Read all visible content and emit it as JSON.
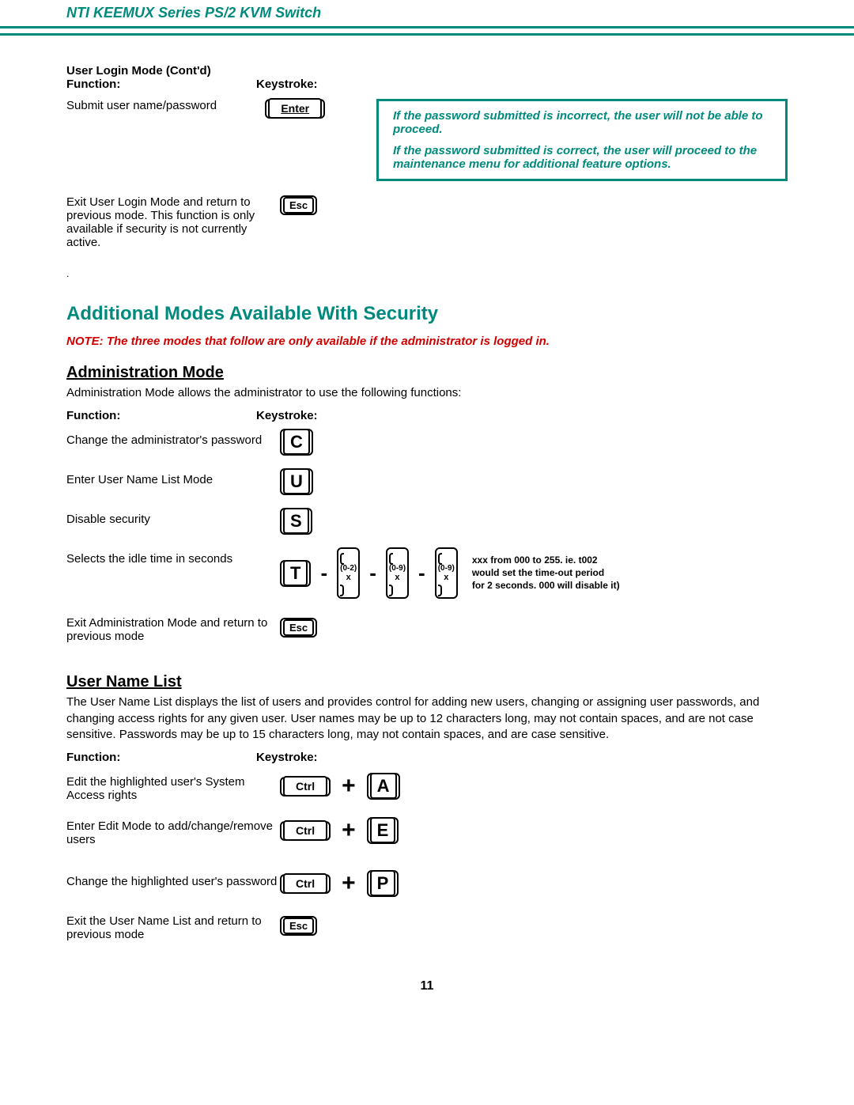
{
  "header": {
    "title": "NTI KEEMUX Series   PS/2 KVM Switch"
  },
  "s1": {
    "title": "User Login Mode (Cont'd)",
    "labels": {
      "function": "Function:",
      "keystroke": "Keystroke:"
    },
    "row1_func": "Submit user name/password",
    "row1_key": "Enter",
    "row2_func": "Exit User Login Mode and return to previous mode. This function is only available if security is not currently active.",
    "row2_key": "Esc",
    "note_p1": "If the password submitted is incorrect, the user will not be able to proceed.",
    "note_p2": "If the password submitted is correct, the user will proceed to the maintenance menu for additional feature options."
  },
  "h_additional": "Additional Modes Available With Security",
  "red_note": "NOTE: The three modes that follow are only available if the administrator is logged in.",
  "admin": {
    "heading": "Administration Mode",
    "intro": "Administration Mode allows the administrator to use the following functions:",
    "labels": {
      "function": "Function:",
      "keystroke": "Keystroke:"
    },
    "r1": {
      "f": "Change the administrator's password",
      "k": "C"
    },
    "r2": {
      "f": "Enter User Name List Mode",
      "k": "U"
    },
    "r3": {
      "f": "Disable security",
      "k": "S"
    },
    "r4": {
      "f": "Selects the idle time in seconds",
      "k": "T",
      "d1_top": "(0-2)",
      "d1_bot": "x",
      "d2_top": "(0-9)",
      "d2_bot": "x",
      "d3_top": "(0-9)",
      "d3_bot": "x",
      "note_l1": "xxx from 000 to 255.   ie.  t002",
      "note_l2": "would set the time-out period",
      "note_l3": "for 2 seconds.  000 will disable it)"
    },
    "r5": {
      "f": "Exit Administration Mode and return to previous mode",
      "k": "Esc"
    }
  },
  "unl": {
    "heading": "User Name List",
    "intro": "The User Name List displays the list of users and provides control for adding new users, changing or assigning user passwords, and changing access rights for any given user.  User names may be up to 12 characters long, may not contain spaces, and are not case sensitive.  Passwords may be up to 15 characters long, may not contain spaces, and are case sensitive.",
    "labels": {
      "function": "Function:",
      "keystroke": "Keystroke:"
    },
    "r1": {
      "f": "Edit the highlighted user's System Access rights",
      "k1": "Ctrl",
      "plus": "+",
      "k2": "A"
    },
    "r2": {
      "f": "Enter Edit Mode to add/change/remove users",
      "k1": "Ctrl",
      "plus": "+",
      "k2": "E"
    },
    "r3": {
      "f": "Change the highlighted user's password",
      "k1": "Ctrl",
      "plus": "+",
      "k2": "P"
    },
    "r4": {
      "f": "Exit the User Name List and return to previous mode",
      "k": "Esc"
    }
  },
  "page_number": "11"
}
